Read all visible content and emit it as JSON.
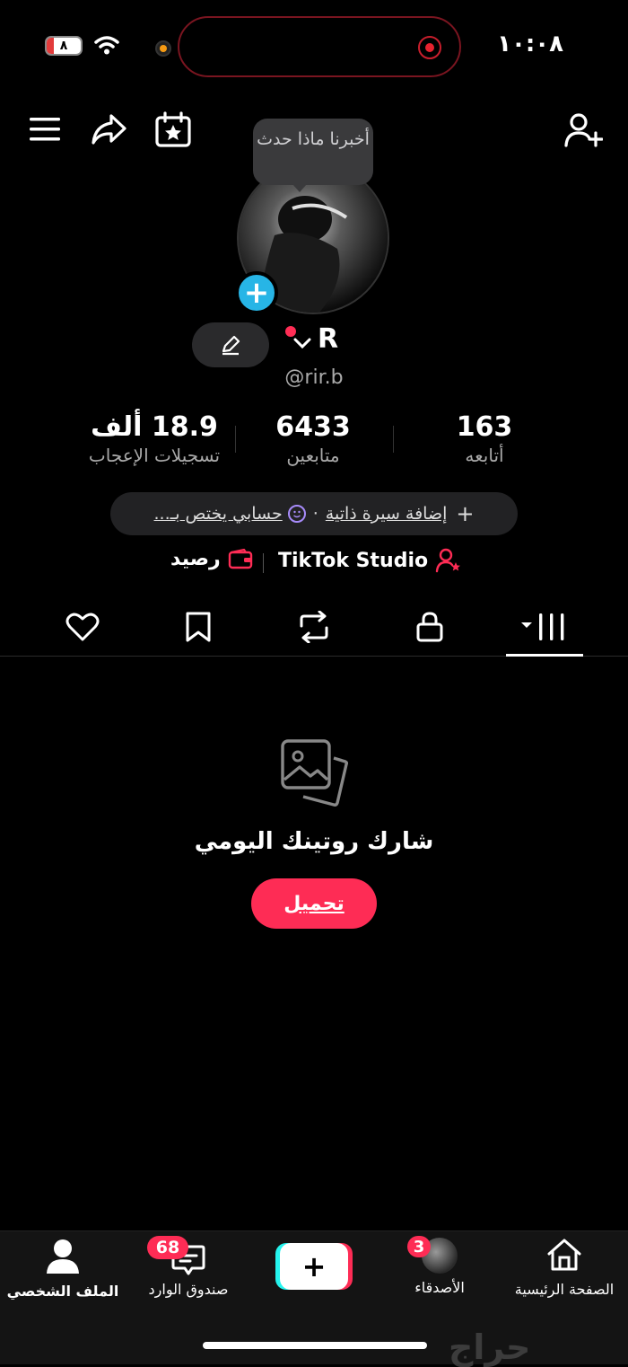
{
  "status_bar": {
    "time": "١٠:٠٨",
    "battery": "٨"
  },
  "header": {
    "menu_icon": "hamburger-icon",
    "share_icon": "share-icon",
    "calendar_icon": "calendar-star-icon",
    "add_friend_icon": "add-user-icon"
  },
  "tooltip": {
    "text": "أخبرنا ماذا حدث"
  },
  "profile": {
    "name": "R",
    "handle": "@rir.b"
  },
  "stats": [
    {
      "value": "163",
      "label": "أتابعه"
    },
    {
      "value": "6433",
      "label": "متابعين"
    },
    {
      "value": "18.9 ألف",
      "label": "تسجيلات الإعجاب"
    }
  ],
  "bio": {
    "add_label": "إضافة سيرة ذاتية",
    "separator": "·",
    "text": "حسابي يختص بـ..."
  },
  "links": {
    "studio": "TikTok Studio",
    "balance": "رصيد"
  },
  "tabs": [
    "videos",
    "private",
    "reposts",
    "favorites",
    "liked"
  ],
  "empty_state": {
    "title": "شارك روتينك اليومي",
    "button": "تحميل"
  },
  "bottom_nav": {
    "home": "الصفحة الرئيسية",
    "friends": "الأصدقاء",
    "friends_badge": "3",
    "create": "+",
    "inbox": "صندوق الوارد",
    "inbox_badge": "68",
    "profile": "الملف الشخصي"
  },
  "watermark": "حراج",
  "colors": {
    "accent": "#fe2c55",
    "cyan": "#25f4ee",
    "blue_badge": "#27b5e6"
  }
}
